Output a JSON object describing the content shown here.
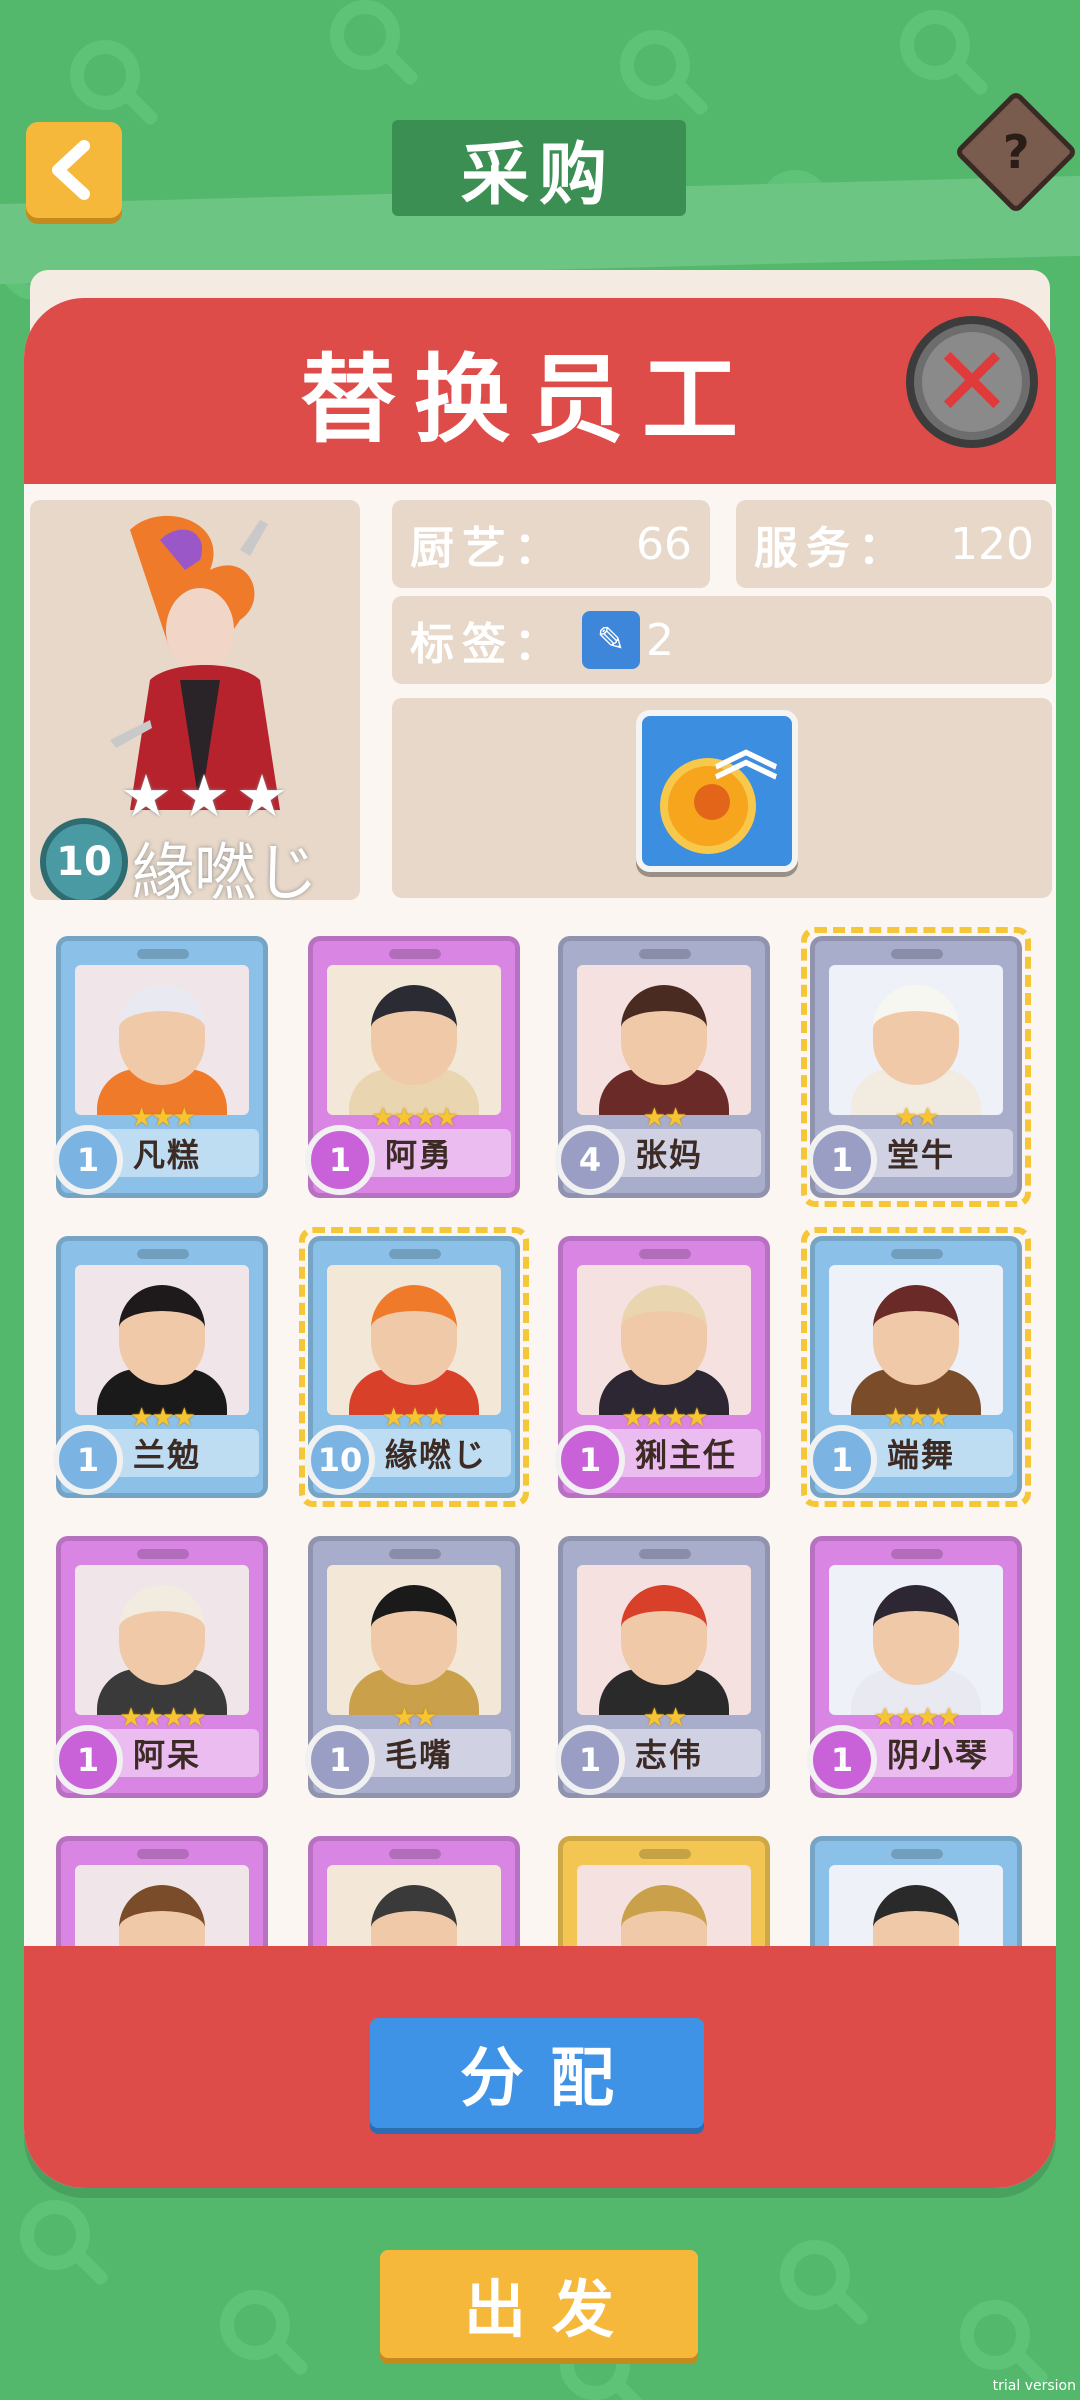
{
  "header": {
    "title": "采购"
  },
  "modal": {
    "title": "替换员工",
    "selected": {
      "name": "緣嘫じ",
      "level": "10",
      "stars": "★★★",
      "cooking_label": "厨艺：",
      "cooking_value": "66",
      "service_label": "服务：",
      "service_value": "120",
      "tag_label": "标签：",
      "tag_value": "2"
    },
    "staff": [
      {
        "name": "凡糕",
        "level": "1",
        "stars": "★★★",
        "color": "blue"
      },
      {
        "name": "阿勇",
        "level": "1",
        "stars": "★★★★",
        "color": "purple"
      },
      {
        "name": "张妈",
        "level": "4",
        "stars": "★★",
        "color": "gray"
      },
      {
        "name": "堂牛",
        "level": "1",
        "stars": "★★",
        "color": "gray"
      },
      {
        "name": "兰勉",
        "level": "1",
        "stars": "★★★",
        "color": "blue"
      },
      {
        "name": "緣嘫じ",
        "level": "10",
        "stars": "★★★",
        "color": "blue"
      },
      {
        "name": "猁主任",
        "level": "1",
        "stars": "★★★★",
        "color": "purple"
      },
      {
        "name": "端舞",
        "level": "1",
        "stars": "★★★",
        "color": "blue"
      },
      {
        "name": "阿呆",
        "level": "1",
        "stars": "★★★★",
        "color": "purple"
      },
      {
        "name": "毛嘴",
        "level": "1",
        "stars": "★★",
        "color": "gray"
      },
      {
        "name": "志伟",
        "level": "1",
        "stars": "★★",
        "color": "gray"
      },
      {
        "name": "阴小琴",
        "level": "1",
        "stars": "★★★★",
        "color": "purple"
      },
      {
        "name": "",
        "level": "",
        "stars": "",
        "color": "purple"
      },
      {
        "name": "",
        "level": "",
        "stars": "",
        "color": "purple"
      },
      {
        "name": "",
        "level": "",
        "stars": "",
        "color": "gold"
      },
      {
        "name": "",
        "level": "",
        "stars": "",
        "color": "blue"
      }
    ],
    "assign_label": "分配"
  },
  "footer": {
    "depart_label": "出发"
  },
  "watermark": "trial version",
  "colors": {
    "background": "#53b86c",
    "modal_red": "#de4c4a",
    "button_blue": "#3f93e6",
    "button_gold": "#f6b83a"
  },
  "icons": {
    "back": "arrow-left-icon",
    "help": "question-icon",
    "close": "close-x-icon",
    "tag": "tag-icon",
    "upgrade": "coin-upgrade-icon"
  }
}
